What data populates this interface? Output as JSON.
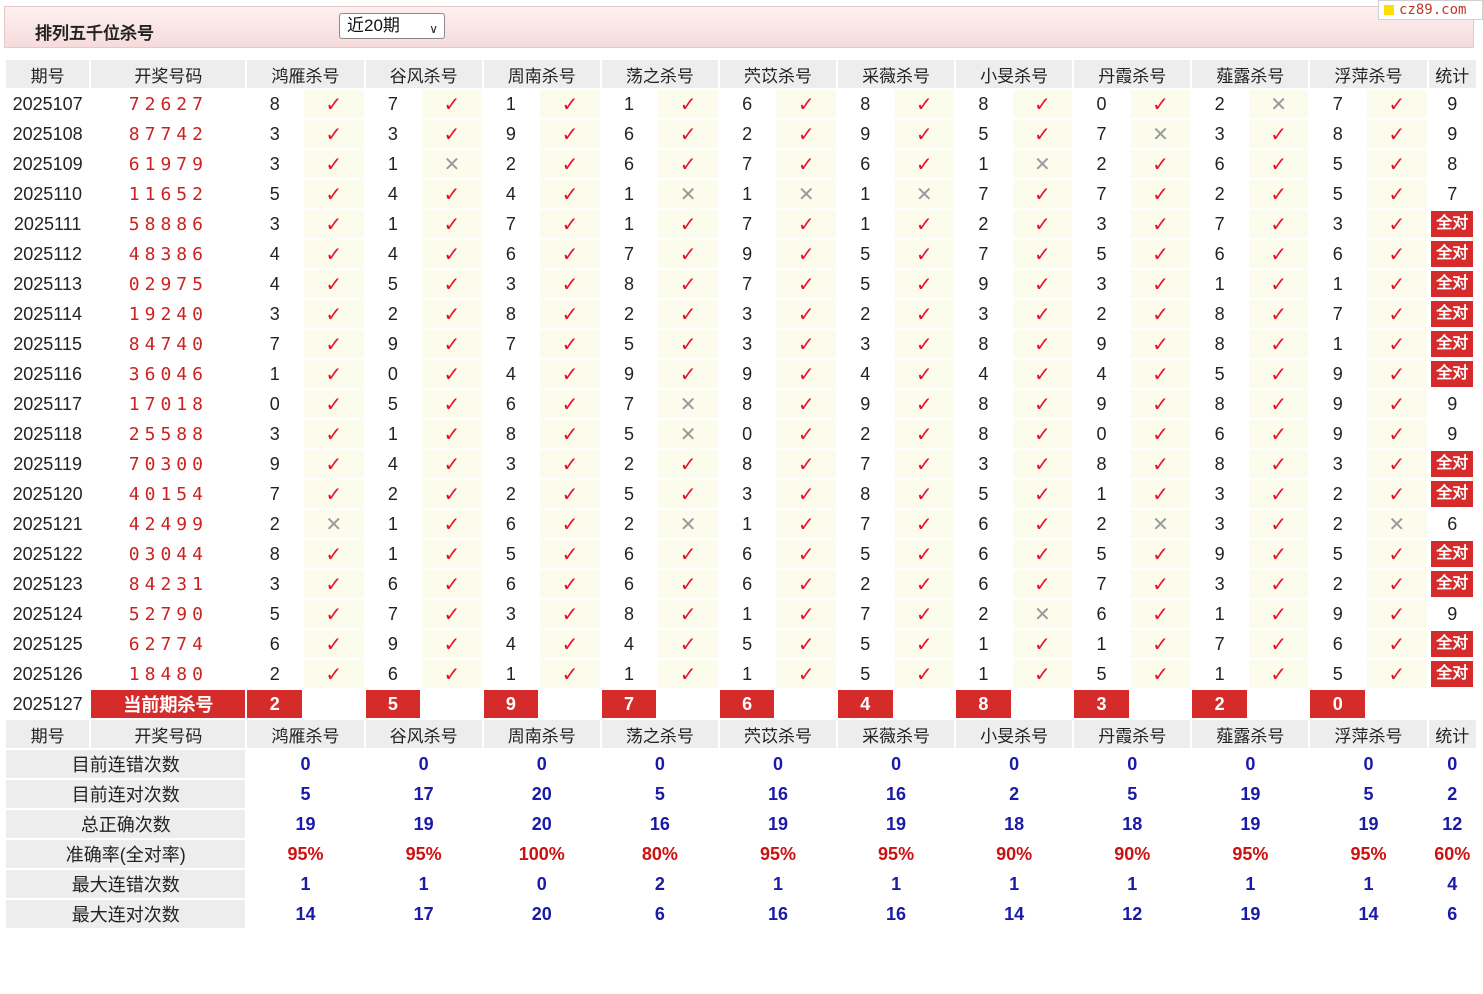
{
  "header": {
    "title": "排列五千位杀号",
    "period_select": "近20期",
    "logo": "cz89.com"
  },
  "columns": {
    "issue": "期号",
    "draw": "开奖号码",
    "stat": "统计",
    "experts": [
      "鸿雁杀号",
      "谷风杀号",
      "周南杀号",
      "荡之杀号",
      "茓苡杀号",
      "采薇杀号",
      "小旻杀号",
      "丹霞杀号",
      "薤露杀号",
      "浮萍杀号"
    ]
  },
  "marks": {
    "ok": "✓",
    "ng": "✕"
  },
  "all_label": "全对",
  "rows": [
    {
      "issue": "2025107",
      "draw": "72627",
      "kills": [
        8,
        7,
        1,
        1,
        6,
        8,
        8,
        0,
        2,
        7
      ],
      "res": [
        1,
        1,
        1,
        1,
        1,
        1,
        1,
        1,
        0,
        1
      ],
      "stat": "9"
    },
    {
      "issue": "2025108",
      "draw": "87742",
      "kills": [
        3,
        3,
        9,
        6,
        2,
        9,
        5,
        7,
        3,
        8
      ],
      "res": [
        1,
        1,
        1,
        1,
        1,
        1,
        1,
        0,
        1,
        1
      ],
      "stat": "9"
    },
    {
      "issue": "2025109",
      "draw": "61979",
      "kills": [
        3,
        1,
        2,
        6,
        7,
        6,
        1,
        2,
        6,
        5
      ],
      "res": [
        1,
        0,
        1,
        1,
        1,
        1,
        0,
        1,
        1,
        1
      ],
      "stat": "8"
    },
    {
      "issue": "2025110",
      "draw": "11652",
      "kills": [
        5,
        4,
        4,
        1,
        1,
        1,
        7,
        7,
        2,
        5
      ],
      "res": [
        1,
        1,
        1,
        0,
        0,
        0,
        1,
        1,
        1,
        1
      ],
      "stat": "7"
    },
    {
      "issue": "2025111",
      "draw": "58886",
      "kills": [
        3,
        1,
        7,
        1,
        7,
        1,
        2,
        3,
        7,
        3
      ],
      "res": [
        1,
        1,
        1,
        1,
        1,
        1,
        1,
        1,
        1,
        1
      ],
      "stat": "全对"
    },
    {
      "issue": "2025112",
      "draw": "48386",
      "kills": [
        4,
        4,
        6,
        7,
        9,
        5,
        7,
        5,
        6,
        6
      ],
      "res": [
        1,
        1,
        1,
        1,
        1,
        1,
        1,
        1,
        1,
        1
      ],
      "stat": "全对"
    },
    {
      "issue": "2025113",
      "draw": "02975",
      "kills": [
        4,
        5,
        3,
        8,
        7,
        5,
        9,
        3,
        1,
        1
      ],
      "res": [
        1,
        1,
        1,
        1,
        1,
        1,
        1,
        1,
        1,
        1
      ],
      "stat": "全对"
    },
    {
      "issue": "2025114",
      "draw": "19240",
      "kills": [
        3,
        2,
        8,
        2,
        3,
        2,
        3,
        2,
        8,
        7
      ],
      "res": [
        1,
        1,
        1,
        1,
        1,
        1,
        1,
        1,
        1,
        1
      ],
      "stat": "全对"
    },
    {
      "issue": "2025115",
      "draw": "84740",
      "kills": [
        7,
        9,
        7,
        5,
        3,
        3,
        8,
        9,
        8,
        1
      ],
      "res": [
        1,
        1,
        1,
        1,
        1,
        1,
        1,
        1,
        1,
        1
      ],
      "stat": "全对"
    },
    {
      "issue": "2025116",
      "draw": "36046",
      "kills": [
        1,
        0,
        4,
        9,
        9,
        4,
        4,
        4,
        5,
        9
      ],
      "res": [
        1,
        1,
        1,
        1,
        1,
        1,
        1,
        1,
        1,
        1
      ],
      "stat": "全对"
    },
    {
      "issue": "2025117",
      "draw": "17018",
      "kills": [
        0,
        5,
        6,
        7,
        8,
        9,
        8,
        9,
        8,
        9
      ],
      "res": [
        1,
        1,
        1,
        0,
        1,
        1,
        1,
        1,
        1,
        1
      ],
      "stat": "9"
    },
    {
      "issue": "2025118",
      "draw": "25588",
      "kills": [
        3,
        1,
        8,
        5,
        0,
        2,
        8,
        0,
        6,
        9
      ],
      "res": [
        1,
        1,
        1,
        0,
        1,
        1,
        1,
        1,
        1,
        1
      ],
      "stat": "9"
    },
    {
      "issue": "2025119",
      "draw": "70300",
      "kills": [
        9,
        4,
        3,
        2,
        8,
        7,
        3,
        8,
        8,
        3
      ],
      "res": [
        1,
        1,
        1,
        1,
        1,
        1,
        1,
        1,
        1,
        1
      ],
      "stat": "全对"
    },
    {
      "issue": "2025120",
      "draw": "40154",
      "kills": [
        7,
        2,
        2,
        5,
        3,
        8,
        5,
        1,
        3,
        2
      ],
      "res": [
        1,
        1,
        1,
        1,
        1,
        1,
        1,
        1,
        1,
        1
      ],
      "stat": "全对"
    },
    {
      "issue": "2025121",
      "draw": "42499",
      "kills": [
        2,
        1,
        6,
        2,
        1,
        7,
        6,
        2,
        3,
        2
      ],
      "res": [
        0,
        1,
        1,
        0,
        1,
        1,
        1,
        0,
        1,
        0
      ],
      "stat": "6"
    },
    {
      "issue": "2025122",
      "draw": "03044",
      "kills": [
        8,
        1,
        5,
        6,
        6,
        5,
        6,
        5,
        9,
        5
      ],
      "res": [
        1,
        1,
        1,
        1,
        1,
        1,
        1,
        1,
        1,
        1
      ],
      "stat": "全对"
    },
    {
      "issue": "2025123",
      "draw": "84231",
      "kills": [
        3,
        6,
        6,
        6,
        6,
        2,
        6,
        7,
        3,
        2
      ],
      "res": [
        1,
        1,
        1,
        1,
        1,
        1,
        1,
        1,
        1,
        1
      ],
      "stat": "全对"
    },
    {
      "issue": "2025124",
      "draw": "52790",
      "kills": [
        5,
        7,
        3,
        8,
        1,
        7,
        2,
        6,
        1,
        9
      ],
      "res": [
        1,
        1,
        1,
        1,
        1,
        1,
        0,
        1,
        1,
        1
      ],
      "stat": "9"
    },
    {
      "issue": "2025125",
      "draw": "62774",
      "kills": [
        6,
        9,
        4,
        4,
        5,
        5,
        1,
        1,
        7,
        6
      ],
      "res": [
        1,
        1,
        1,
        1,
        1,
        1,
        1,
        1,
        1,
        1
      ],
      "stat": "全对"
    },
    {
      "issue": "2025126",
      "draw": "18480",
      "kills": [
        2,
        6,
        1,
        1,
        1,
        5,
        1,
        5,
        1,
        5
      ],
      "res": [
        1,
        1,
        1,
        1,
        1,
        1,
        1,
        1,
        1,
        1
      ],
      "stat": "全对"
    }
  ],
  "current": {
    "issue": "2025127",
    "label": "当前期杀号",
    "kills": [
      2,
      5,
      9,
      7,
      6,
      4,
      8,
      3,
      2,
      0
    ]
  },
  "summary": [
    {
      "label": "目前连错次数",
      "values": [
        "0",
        "0",
        "0",
        "0",
        "0",
        "0",
        "0",
        "0",
        "0",
        "0"
      ],
      "stat": "0",
      "pct": false
    },
    {
      "label": "目前连对次数",
      "values": [
        "5",
        "17",
        "20",
        "5",
        "16",
        "16",
        "2",
        "5",
        "19",
        "5"
      ],
      "stat": "2",
      "pct": false
    },
    {
      "label": "总正确次数",
      "values": [
        "19",
        "19",
        "20",
        "16",
        "19",
        "19",
        "18",
        "18",
        "19",
        "19"
      ],
      "stat": "12",
      "pct": false
    },
    {
      "label": "准确率(全对率)",
      "values": [
        "95%",
        "95%",
        "100%",
        "80%",
        "95%",
        "95%",
        "90%",
        "90%",
        "95%",
        "95%"
      ],
      "stat": "60%",
      "pct": true
    },
    {
      "label": "最大连错次数",
      "values": [
        "1",
        "1",
        "0",
        "2",
        "1",
        "1",
        "1",
        "1",
        "1",
        "1"
      ],
      "stat": "4",
      "pct": false
    },
    {
      "label": "最大连对次数",
      "values": [
        "14",
        "17",
        "20",
        "6",
        "16",
        "16",
        "14",
        "12",
        "19",
        "14"
      ],
      "stat": "6",
      "pct": false
    }
  ]
}
